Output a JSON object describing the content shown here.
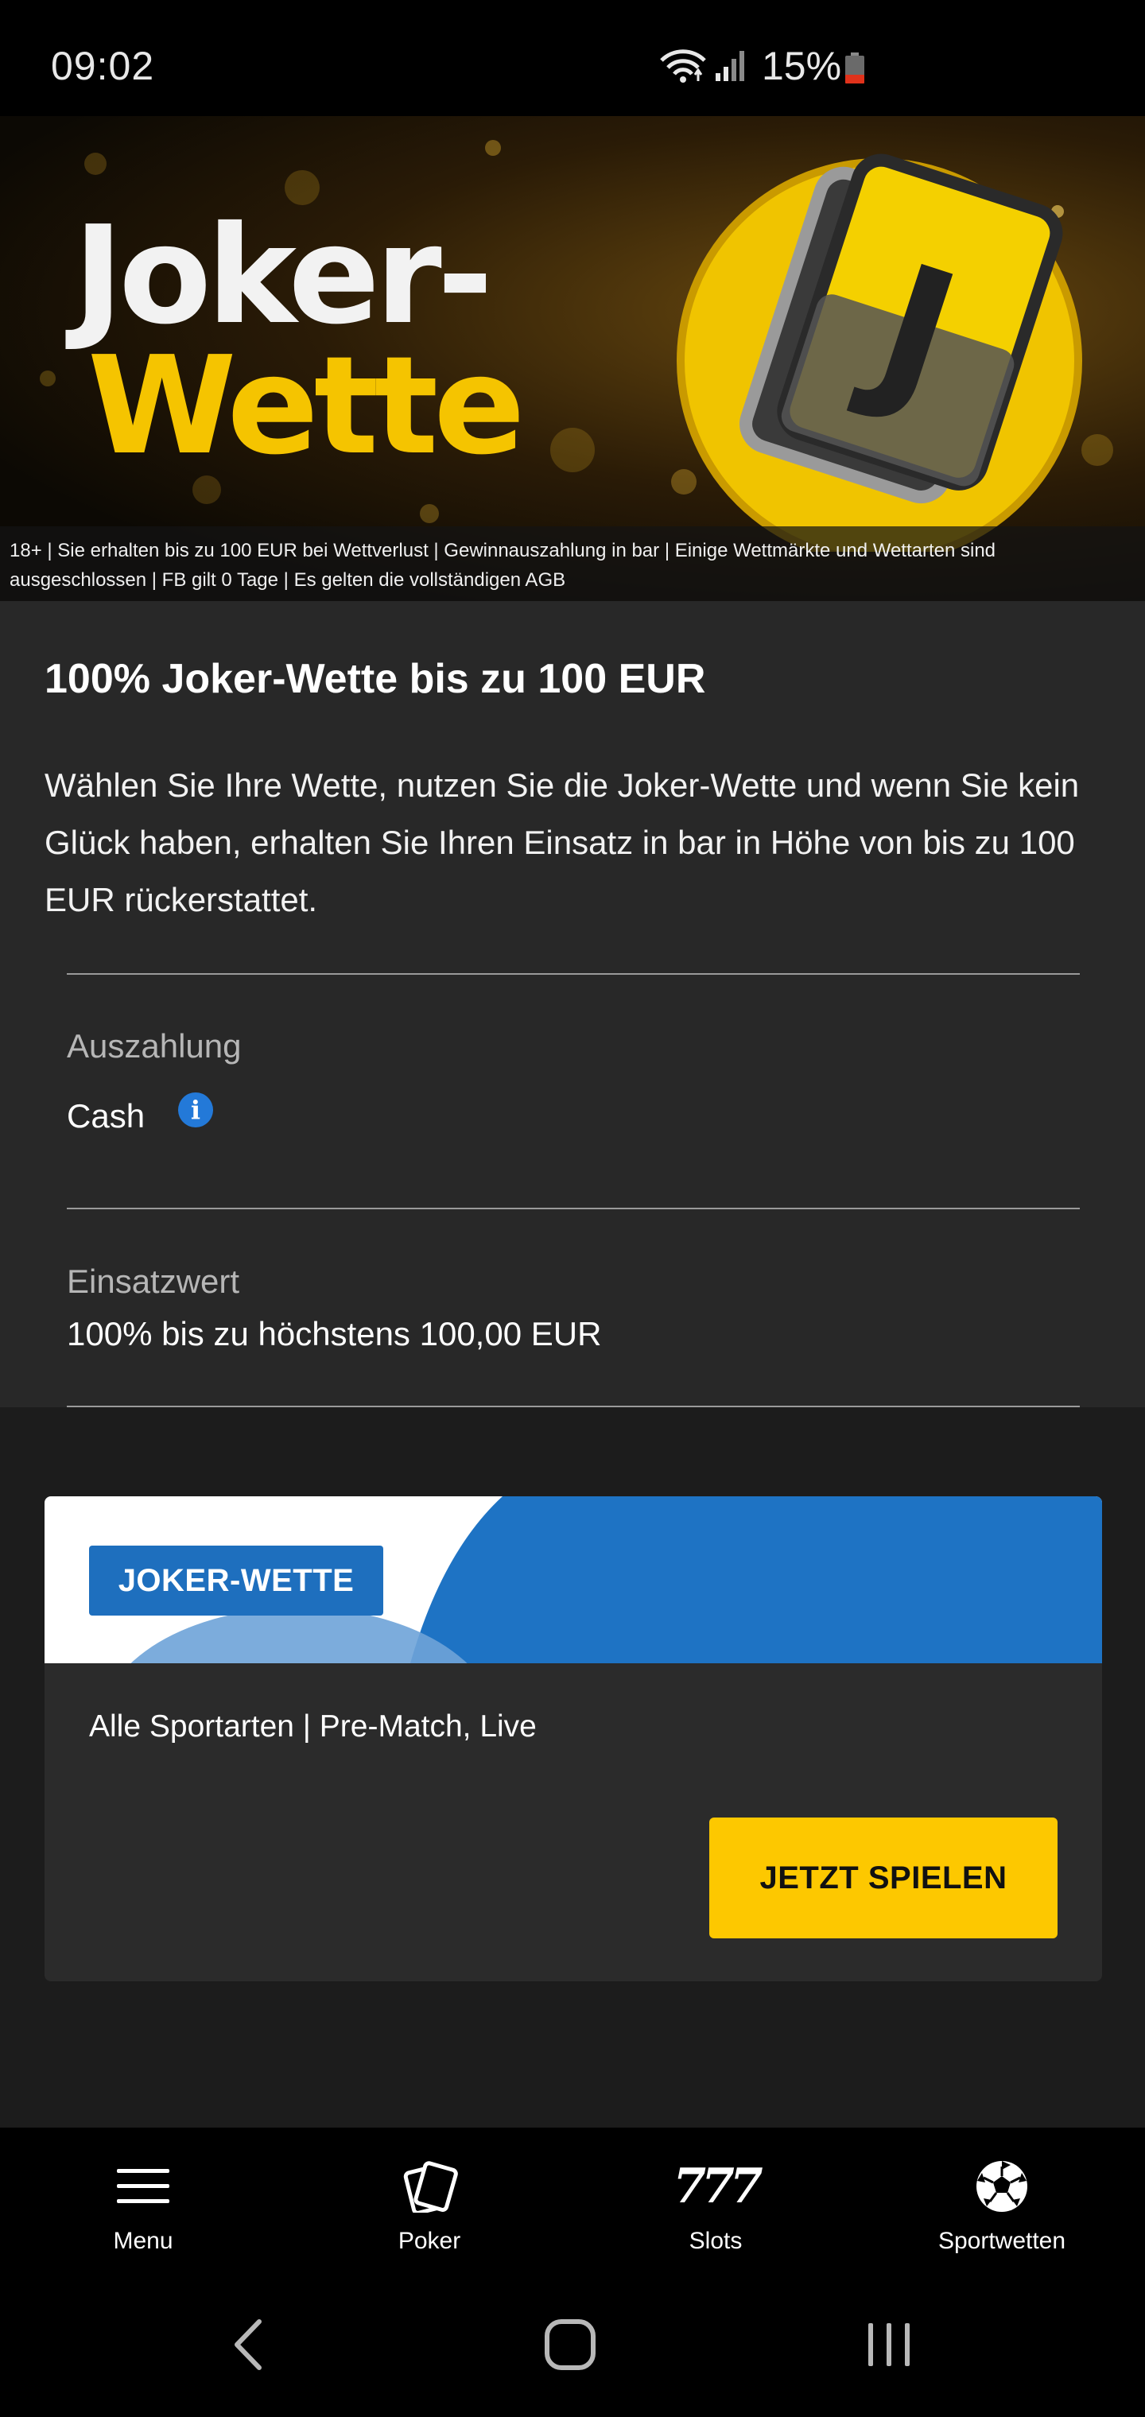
{
  "status_bar": {
    "time": "09:02",
    "battery_percent": "15%",
    "battery_color": "#e0321b"
  },
  "hero": {
    "title_line1": "Joker-",
    "title_line2": "Wette",
    "disclaimer": "18+ | Sie erhalten bis zu 100 EUR bei Wettverlust | Gewinnauszahlung in bar | Einige Wettmärkte und Wettarten sind ausgeschlossen | FB gilt 0 Tage | Es gelten die vollständigen AGB",
    "logo_letter": "J"
  },
  "offer": {
    "title": "100% Joker-Wette bis zu 100 EUR",
    "description": "Wählen Sie Ihre Wette, nutzen Sie die Joker-Wette und wenn Sie kein Glück haben, erhalten Sie Ihren Einsatz in bar in Höhe von bis zu 100 EUR rückerstattet.",
    "payout_label": "Auszahlung",
    "payout_value": "Cash",
    "stake_label": "Einsatzwert",
    "stake_value": "100% bis zu höchstens 100,00 EUR"
  },
  "card": {
    "badge": "JOKER-WETTE",
    "subtitle": "Alle Sportarten | Pre-Match, Live",
    "cta": "JETZT SPIELEN",
    "accent_color": "#1e6fbe",
    "cta_color": "#fdc800"
  },
  "bottom_nav": {
    "items": [
      {
        "label": "Menu",
        "icon": "hamburger-icon"
      },
      {
        "label": "Poker",
        "icon": "cards-icon"
      },
      {
        "label": "Slots",
        "icon": "777-icon",
        "glyph": "777"
      },
      {
        "label": "Sportwetten",
        "icon": "soccer-ball-icon"
      }
    ]
  }
}
